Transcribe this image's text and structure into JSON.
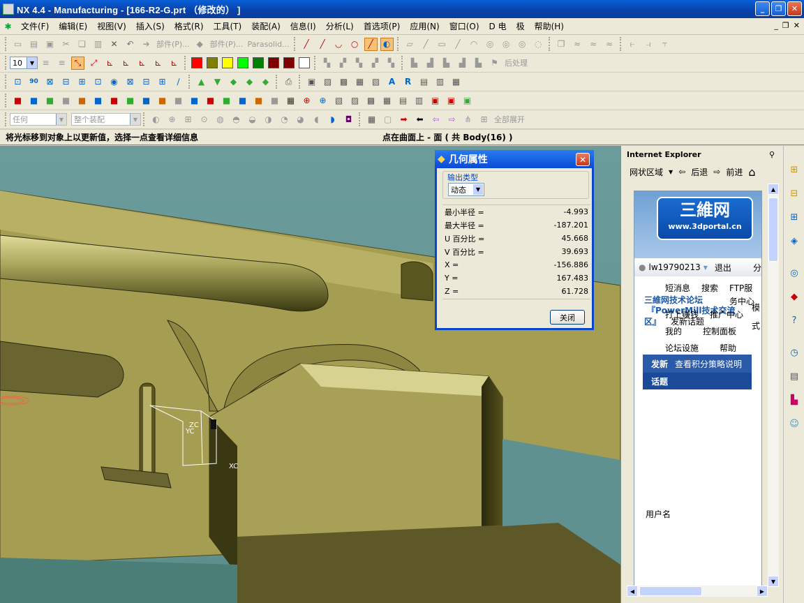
{
  "window": {
    "title": "NX 4.4 - Manufacturing - [166-R2-G.prt （修改的） ]",
    "min": "_",
    "max": "❐",
    "close": "✕"
  },
  "menu": [
    "文件(F)",
    "编辑(E)",
    "视图(V)",
    "插入(S)",
    "格式(R)",
    "工具(T)",
    "装配(A)",
    "信息(I)",
    "分析(L)",
    "首选项(P)",
    "应用(N)",
    "窗口(O)",
    "D 电",
    "极",
    "帮助(H)"
  ],
  "toolbar": {
    "part_label1": "部件(P)...",
    "part_label2": "部件(P)...",
    "parasolid_label": "Parasolid...",
    "layer_value": "10",
    "colors": [
      "#ff0000",
      "#808000",
      "#ffff00",
      "#00ff00",
      "#008000",
      "#800000",
      "#800000",
      "#ffffff"
    ],
    "postprocess": "后处理",
    "filter_value": "任何",
    "assembly_value": "整个装配",
    "expand_all": "全部展开"
  },
  "status": {
    "left": "将光标移到对象上以更新值，选择一点查看详细信息",
    "right": "点在曲面上 - 面 ( 共 Body(16) )"
  },
  "viewport": {
    "axis_zc": "ZC",
    "axis_yc": "YC",
    "axis_xc": "XC"
  },
  "dialog": {
    "title": "几何属性",
    "output_group": "输出类型",
    "output_value": "动态",
    "rows": [
      {
        "label": "最小半径 =",
        "value": "-4.993"
      },
      {
        "label": "最大半径 =",
        "value": "-187.201"
      },
      {
        "label": "U 百分比 =",
        "value": "45.668"
      },
      {
        "label": "V 百分比 =",
        "value": "39.693"
      },
      {
        "label": "X =",
        "value": "-156.886"
      },
      {
        "label": "Y =",
        "value": "167.483"
      },
      {
        "label": "Z =",
        "value": "61.728"
      }
    ],
    "close_button": "关闭"
  },
  "ie": {
    "title": "Internet Explorer",
    "zone": "网状区域",
    "back": "后退",
    "forward": "前进",
    "logo_cn": "三維网",
    "logo_url": "www.3dportal.cn",
    "username": "lw19790213",
    "logout": "退出",
    "fen": "分",
    "shortmsg": "短消息",
    "search": "搜索",
    "ftp": "FTP服",
    "forum": "三維网技术论坛",
    "service": "务中心",
    "powermill": "『PowerMill技术交流",
    "area": "区』",
    "mode": "模",
    "shi": "式",
    "print": "打上赚钱",
    "push": "推广中心",
    "post_new": "发新话题",
    "my": "我的",
    "panel": "控制面板",
    "forum_settings": "论坛设施",
    "help": "帮助",
    "post": "发新",
    "points": "查看积分策略说明",
    "topic": "话题",
    "user_label": "用户名"
  }
}
